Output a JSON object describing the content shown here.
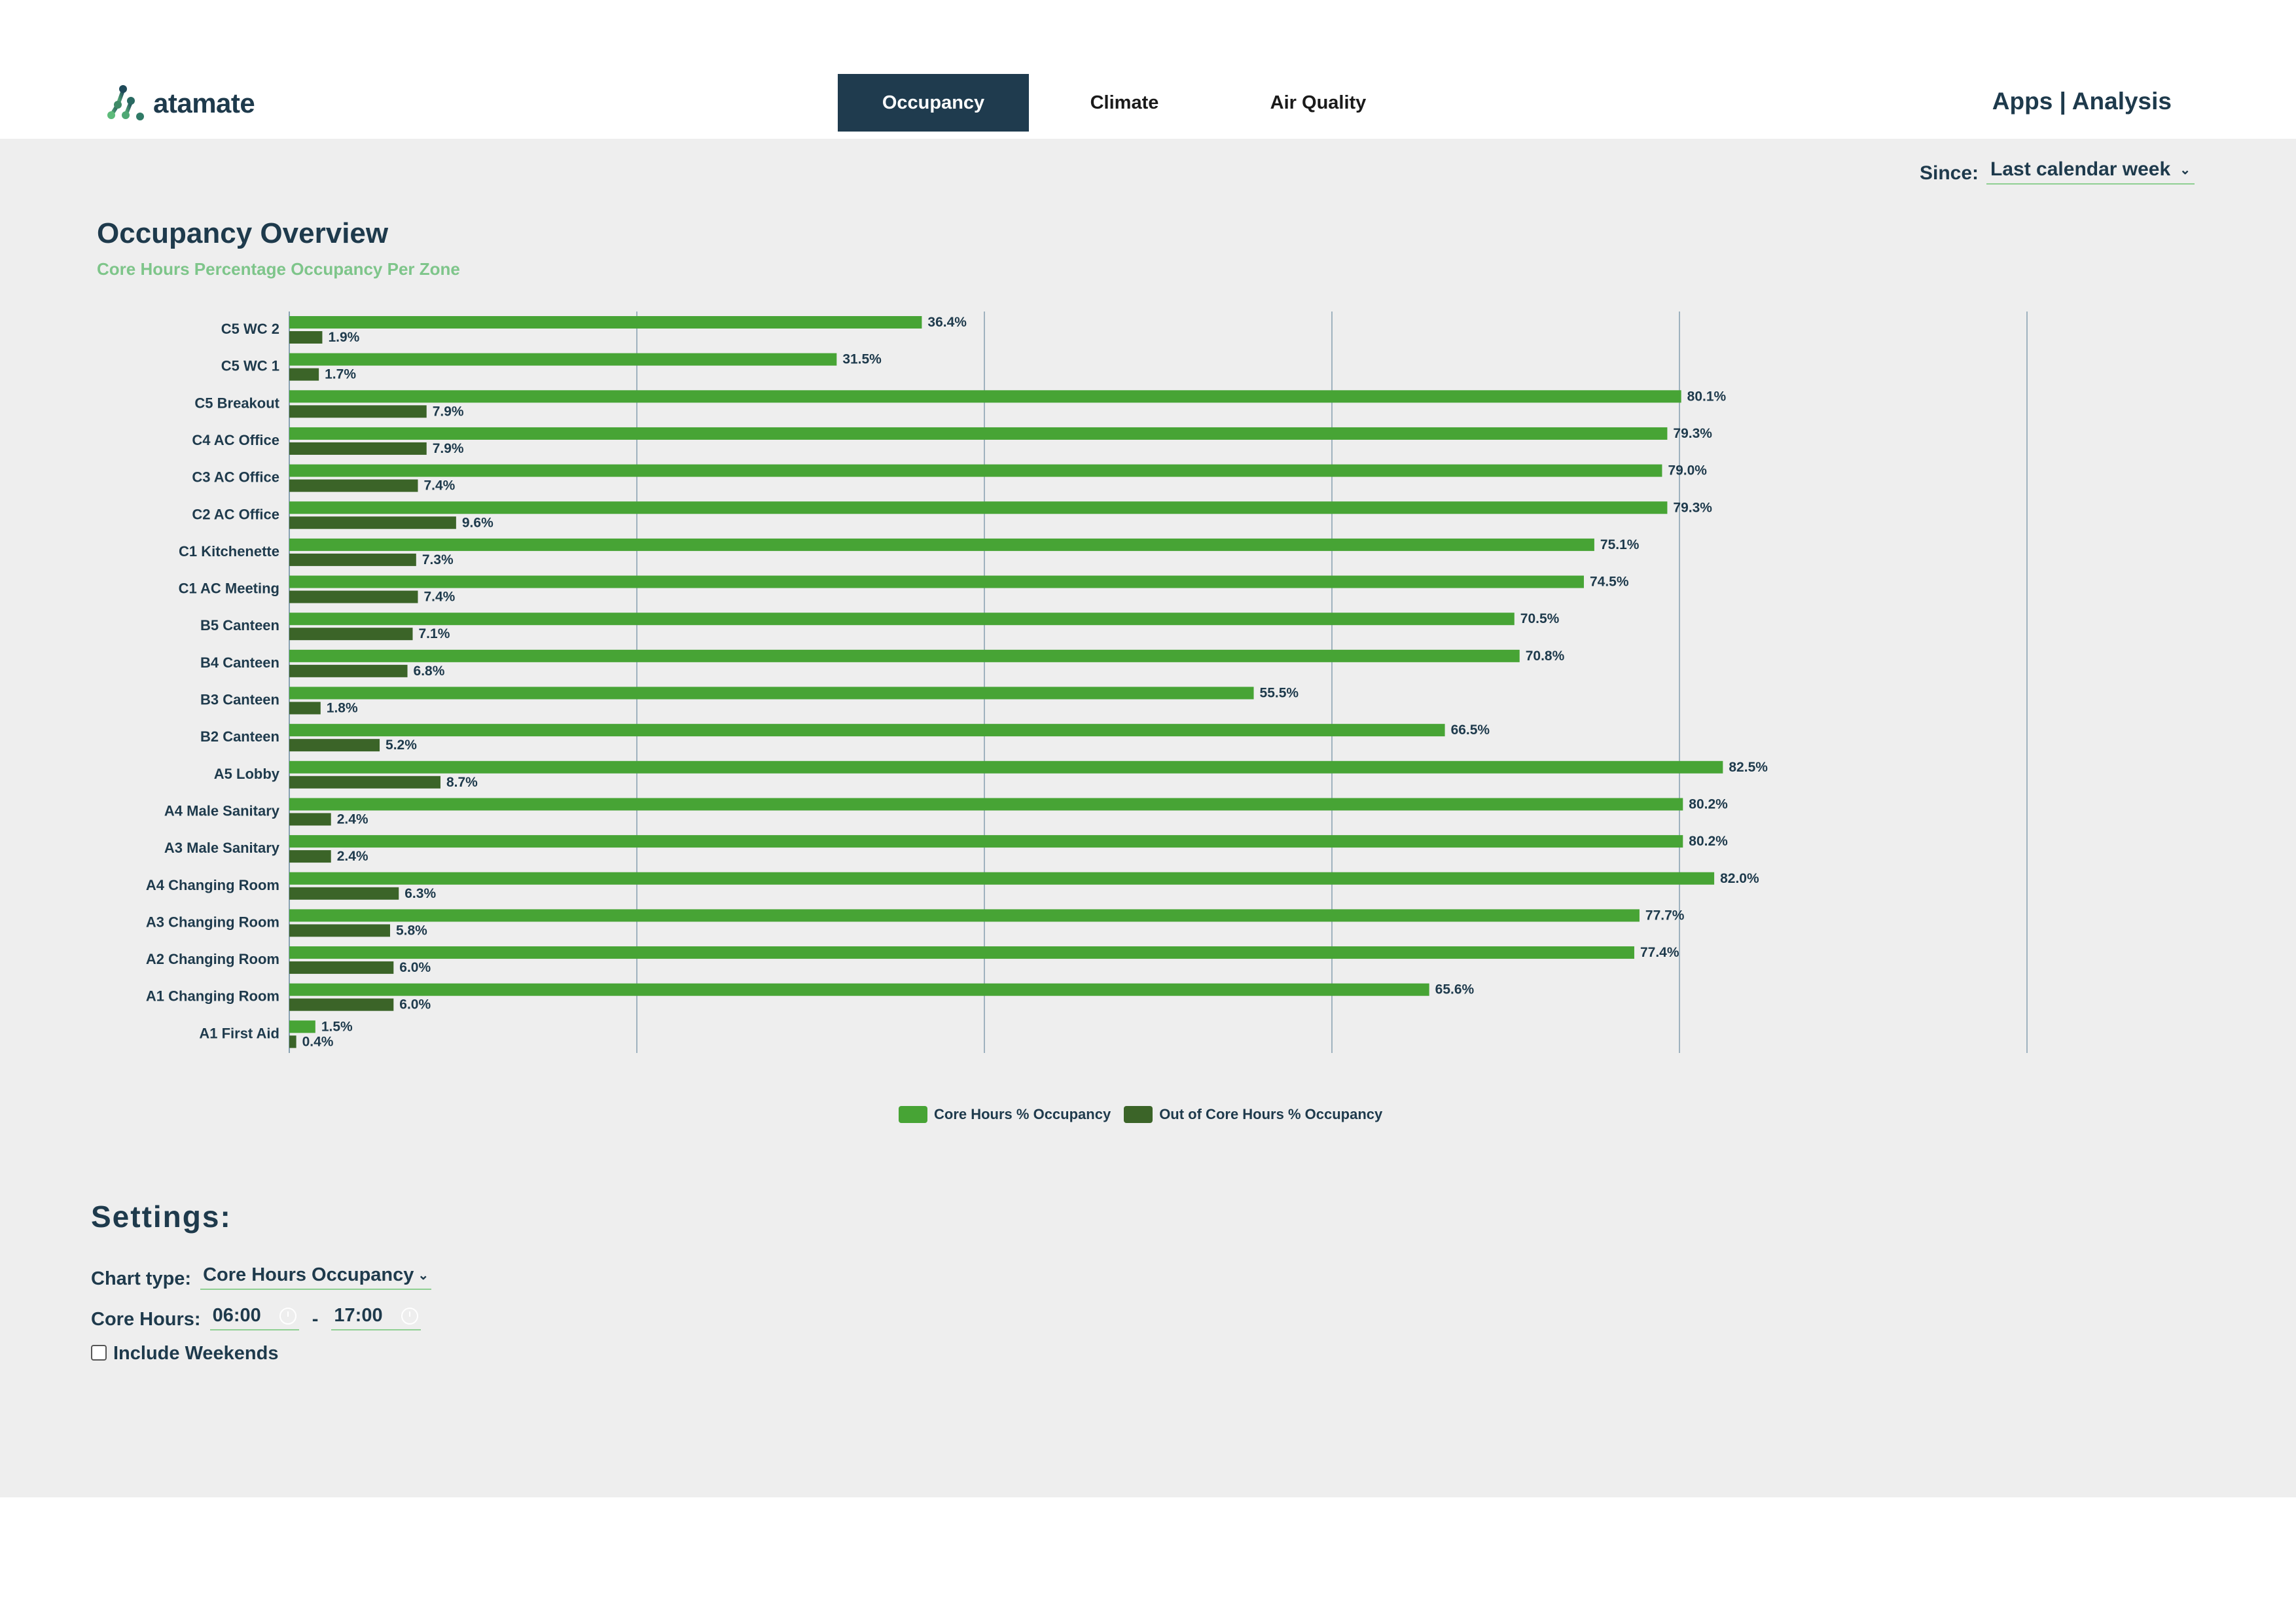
{
  "header": {
    "brand": "atamate",
    "tabs": [
      {
        "label": "Occupancy",
        "active": true
      },
      {
        "label": "Climate",
        "active": false
      },
      {
        "label": "Air Quality",
        "active": false
      }
    ],
    "apps_link": "Apps | Analysis"
  },
  "filters": {
    "since_label": "Since:",
    "since_value": "Last calendar week"
  },
  "page": {
    "title": "Occupancy Overview",
    "subtitle": "Core Hours Percentage Occupancy Per Zone"
  },
  "colors": {
    "core": "#47a435",
    "out_of_core": "#3b6428",
    "accent_underline": "#8fcf92",
    "text": "#1e3a4c",
    "tab_active": "#1f3b4e",
    "subtitle": "#7ec58a"
  },
  "chart_data": {
    "type": "bar",
    "orientation": "horizontal",
    "title": "Occupancy Overview",
    "subtitle": "Core Hours Percentage Occupancy Per Zone",
    "xlabel": "",
    "ylabel": "",
    "xlim": [
      0,
      100
    ],
    "grid": true,
    "grid_step": 20,
    "legend_position": "bottom",
    "categories": [
      "C5 WC 2",
      "C5 WC 1",
      "C5 Breakout",
      "C4 AC Office",
      "C3 AC Office",
      "C2 AC Office",
      "C1 Kitchenette",
      "C1 AC Meeting",
      "B5 Canteen",
      "B4 Canteen",
      "B3 Canteen",
      "B2 Canteen",
      "A5 Lobby",
      "A4 Male Sanitary",
      "A3 Male Sanitary",
      "A4 Changing Room",
      "A3 Changing Room",
      "A2 Changing Room",
      "A1 Changing Room",
      "A1 First Aid"
    ],
    "series": [
      {
        "name": "Core Hours % Occupancy",
        "values": [
          36.4,
          31.5,
          80.1,
          79.3,
          79.0,
          79.3,
          75.1,
          74.5,
          70.5,
          70.8,
          55.5,
          66.5,
          82.5,
          80.2,
          80.2,
          82.0,
          77.7,
          77.4,
          65.6,
          1.5
        ]
      },
      {
        "name": "Out of Core Hours % Occupancy",
        "values": [
          1.9,
          1.7,
          7.9,
          7.9,
          7.4,
          9.6,
          7.3,
          7.4,
          7.1,
          6.8,
          1.8,
          5.2,
          8.7,
          2.4,
          2.4,
          6.3,
          5.8,
          6.0,
          6.0,
          0.4
        ]
      }
    ],
    "value_suffix": "%"
  },
  "settings": {
    "title": "Settings:",
    "chart_type_label": "Chart type:",
    "chart_type_value": "Core Hours Occupancy",
    "core_hours_label": "Core Hours:",
    "core_hours_start": "06:00",
    "core_hours_separator": "-",
    "core_hours_end": "17:00",
    "include_weekends_label": "Include Weekends",
    "include_weekends_checked": false
  }
}
